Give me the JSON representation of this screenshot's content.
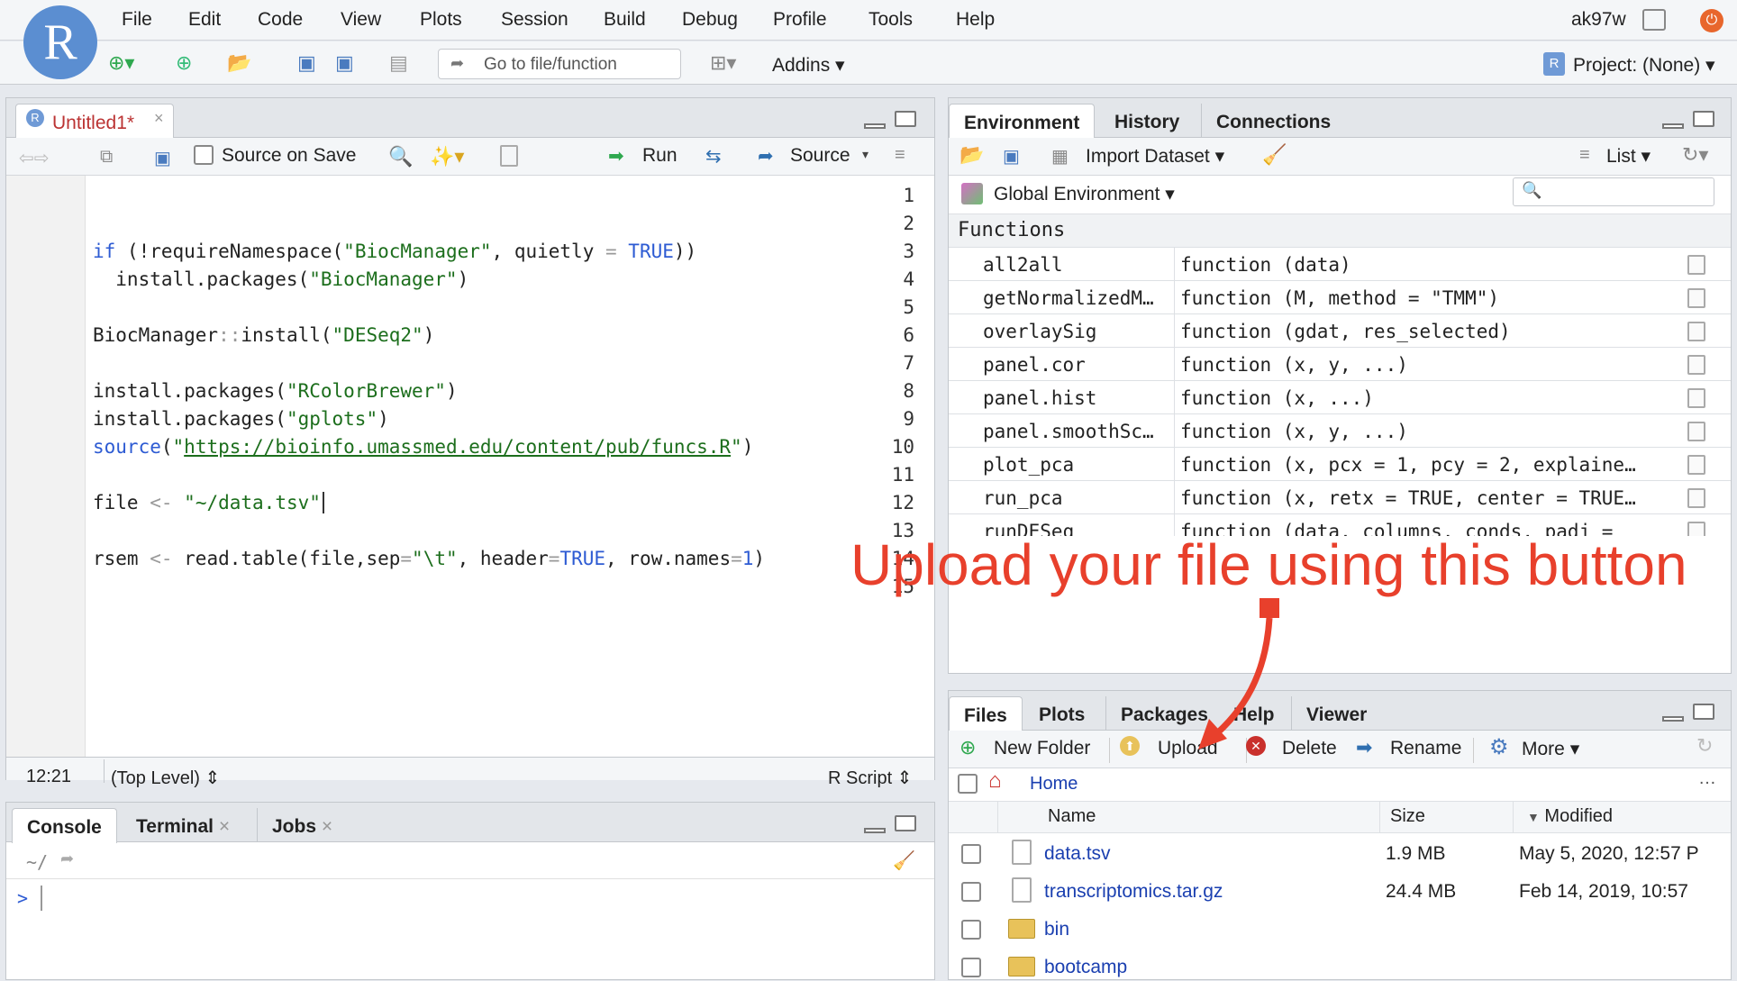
{
  "app": {
    "logo_letter": "R",
    "user": "ak97w"
  },
  "menu": [
    "File",
    "Edit",
    "Code",
    "View",
    "Plots",
    "Session",
    "Build",
    "Debug",
    "Profile",
    "Tools",
    "Help"
  ],
  "toolbar": {
    "goto_placeholder": "Go to file/function",
    "addins": "Addins",
    "project": "Project: (None)"
  },
  "editor": {
    "tab_title": "Untitled1*",
    "source_on_save": "Source on Save",
    "run": "Run",
    "source": "Source",
    "status_position": "12:21",
    "status_scope": "(Top Level)",
    "status_type": "R Script",
    "line_numbers": [
      "1",
      "2",
      "3",
      "4",
      "5",
      "6",
      "7",
      "8",
      "9",
      "10",
      "11",
      "12",
      "13",
      "14",
      "15"
    ]
  },
  "console": {
    "tabs": [
      "Console",
      "Terminal",
      "Jobs"
    ],
    "path": "~/",
    "prompt": ">"
  },
  "environment": {
    "tabs": [
      "Environment",
      "History",
      "Connections"
    ],
    "import_dataset": "Import Dataset",
    "list_view": "List",
    "scope": "Global Environment",
    "section": "Functions",
    "rows": [
      {
        "name": "all2all",
        "value": "function (data)"
      },
      {
        "name": "getNormalizedM…",
        "value": "function (M, method = \"TMM\")"
      },
      {
        "name": "overlaySig",
        "value": "function (gdat, res_selected)"
      },
      {
        "name": "panel.cor",
        "value": "function (x, y, ...)"
      },
      {
        "name": "panel.hist",
        "value": "function (x, ...)"
      },
      {
        "name": "panel.smoothSc…",
        "value": "function (x, y, ...)"
      },
      {
        "name": "plot_pca",
        "value": "function (x, pcx = 1, pcy = 2, explaine…"
      },
      {
        "name": "run_pca",
        "value": "function (x, retx = TRUE, center = TRUE…"
      },
      {
        "name": "runDESeq",
        "value": "function (data, columns, conds, padj ="
      }
    ]
  },
  "files": {
    "tabs": [
      "Files",
      "Plots",
      "Packages",
      "Help",
      "Viewer"
    ],
    "new_folder": "New Folder",
    "upload": "Upload",
    "delete": "Delete",
    "rename": "Rename",
    "more": "More",
    "breadcrumb": "Home",
    "col_name": "Name",
    "col_size": "Size",
    "col_modified": "Modified",
    "rows": [
      {
        "name": "data.tsv",
        "size": "1.9 MB",
        "modified": "May 5, 2020, 12:57 P",
        "type": "file"
      },
      {
        "name": "transcriptomics.tar.gz",
        "size": "24.4 MB",
        "modified": "Feb 14, 2019, 10:57",
        "type": "file"
      },
      {
        "name": "bin",
        "size": "",
        "modified": "",
        "type": "folder"
      },
      {
        "name": "bootcamp",
        "size": "",
        "modified": "",
        "type": "folder"
      }
    ]
  },
  "annotation": {
    "text": "Upload your file using this button",
    "color": "#e8402c"
  }
}
